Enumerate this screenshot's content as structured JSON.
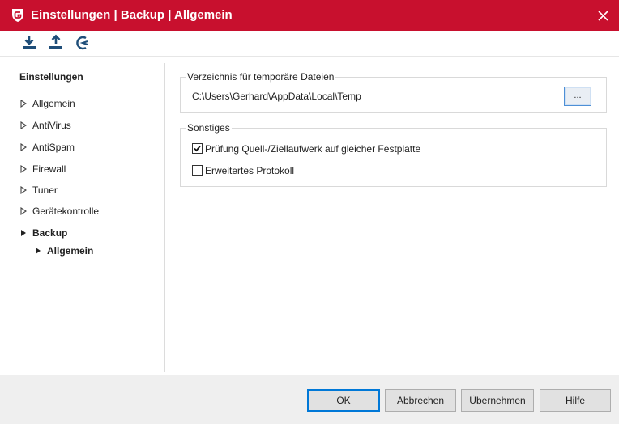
{
  "window": {
    "title": "Einstellungen | Backup | Allgemein",
    "accent_color": "#c8102e",
    "logo_icon": "gdata-shield-logo",
    "close_icon": "close-icon"
  },
  "toolbar": {
    "buttons": [
      {
        "icon": "import-icon"
      },
      {
        "icon": "export-icon"
      },
      {
        "icon": "reset-icon"
      }
    ]
  },
  "sidebar": {
    "heading": "Einstellungen",
    "items": [
      {
        "label": "Allgemein"
      },
      {
        "label": "AntiVirus"
      },
      {
        "label": "AntiSpam"
      },
      {
        "label": "Firewall"
      },
      {
        "label": "Tuner"
      },
      {
        "label": "Gerätekontrolle"
      },
      {
        "label": "Backup",
        "expanded": true
      },
      {
        "label": "Allgemein",
        "selected": true
      }
    ]
  },
  "temp_dir": {
    "title": "Verzeichnis für temporäre Dateien",
    "path": "C:\\Users\\Gerhard\\AppData\\Local\\Temp",
    "browse_label": "..."
  },
  "misc": {
    "title": "Sonstiges",
    "options": [
      {
        "label": "Prüfung Quell-/Ziellaufwerk auf gleicher Festplatte",
        "checked": true
      },
      {
        "label": "Erweitertes Protokoll",
        "checked": false
      }
    ]
  },
  "footer": {
    "ok": "OK",
    "cancel": "Abbrechen",
    "apply_u": "Ü",
    "apply_rest": "bernehmen",
    "help": "Hilfe"
  }
}
